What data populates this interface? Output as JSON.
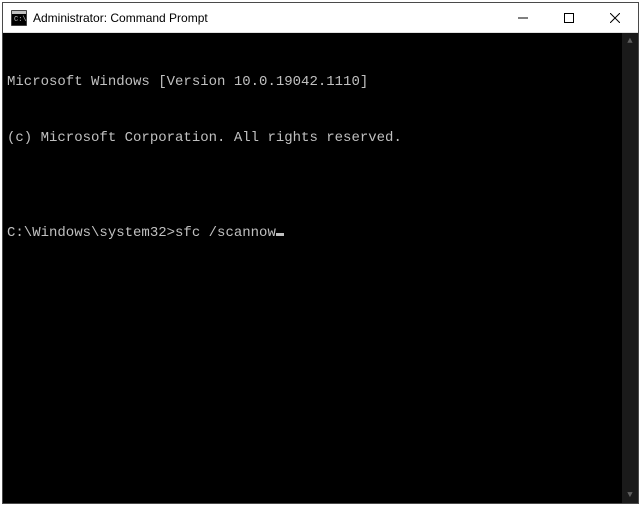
{
  "window": {
    "title": "Administrator: Command Prompt"
  },
  "terminal": {
    "line1": "Microsoft Windows [Version 10.0.19042.1110]",
    "line2": "(c) Microsoft Corporation. All rights reserved.",
    "blank1": "",
    "prompt": "C:\\Windows\\system32>",
    "command": "sfc /scannow"
  },
  "icons": {
    "app": "cmd-icon",
    "minimize": "minimize-icon",
    "maximize": "maximize-icon",
    "close": "close-icon",
    "scroll_up": "▲",
    "scroll_down": "▼"
  }
}
